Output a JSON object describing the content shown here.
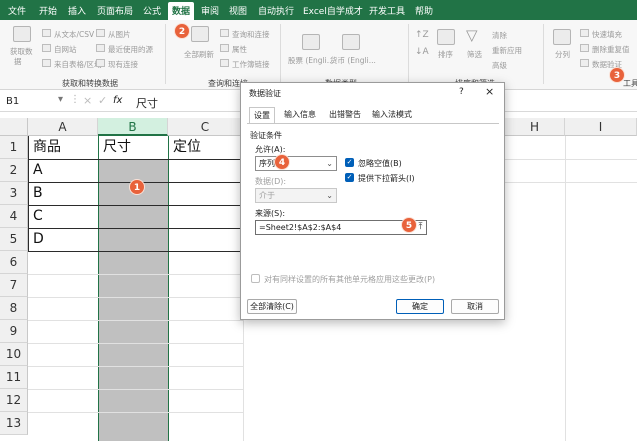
{
  "menu": [
    "文件",
    "开始",
    "插入",
    "页面布局",
    "公式",
    "数据",
    "审阅",
    "视图",
    "自动执行",
    "Excel自学成才",
    "开发工具",
    "帮助"
  ],
  "ribbon": {
    "get_data": [
      "获取数",
      "据"
    ],
    "from_text_csv": "从文本/CSV",
    "from_web": "自网站",
    "from_table_range": "来自表格/区域",
    "from_picture": "从图片",
    "recent_sources": "最近使用的源",
    "existing_connections": "现有连接",
    "group_get_transform": "获取和转换数据",
    "refresh_all": "全部刷新",
    "queries_connections": "查询和连接",
    "properties": "属性",
    "edit_links": "工作簿链接",
    "group_queries": "查询和连接",
    "stocks": "股票 (Engli...",
    "currencies": "货币 (Engli...",
    "group_data_types": "数据类型",
    "sort": "排序",
    "filter": "筛选",
    "clear": "清除",
    "reapply": "重新应用",
    "advanced": "高级",
    "group_sort_filter": "排序和筛选",
    "split": "分列",
    "flash_fill": "快速填充",
    "remove_dup": "删除重复值",
    "data_validation": "数据验证",
    "group_tools": "工具"
  },
  "formula_bar": {
    "name_box": "B1",
    "fx": "fx",
    "content": "尺寸"
  },
  "columns": [
    "A",
    "B",
    "C",
    "H",
    "I"
  ],
  "rows": [
    "1",
    "2",
    "3",
    "4",
    "5",
    "6",
    "7",
    "8",
    "9",
    "10",
    "11",
    "12",
    "13"
  ],
  "cells": {
    "A1": "商品",
    "B1": "尺寸",
    "C1": "定位",
    "A2": "A",
    "A3": "B",
    "A4": "C",
    "A5": "D"
  },
  "dialog": {
    "title": "数据验证",
    "help": "?",
    "close": "×",
    "tabs": [
      "设置",
      "输入信息",
      "出错警告",
      "输入法模式"
    ],
    "section": "验证条件",
    "allow_label": "允许(A):",
    "allow_value": "序列",
    "data_label": "数据(D):",
    "data_value": "介于",
    "ignore_blank": "忽略空值(B)",
    "dropdown": "提供下拉箭头(I)",
    "source_label": "来源(S):",
    "source_value": "=Sheet2!$A$2:$A$4",
    "apply_all": "对有同样设置的所有其他单元格应用这些更改(P)",
    "clear_all": "全部清除(C)",
    "ok": "确定",
    "cancel": "取消"
  },
  "callouts": [
    "1",
    "2",
    "3",
    "4",
    "5"
  ],
  "colors": {
    "accent": "#217346",
    "selection": "#c0c0c0",
    "callout": "#e8623b",
    "dialog_accent": "#005fb8"
  }
}
